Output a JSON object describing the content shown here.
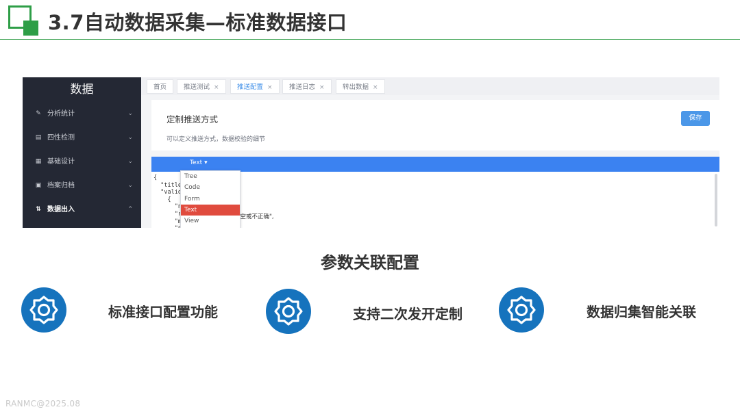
{
  "slide": {
    "title": "3.7自动数据采集—标准数据接口",
    "section_heading": "参数关联配置",
    "footer": "RANMC@2025.08"
  },
  "app": {
    "brand": "数据",
    "sidebar": [
      {
        "label": "分析统计",
        "icon": "edit-icon",
        "chevron": "⌄"
      },
      {
        "label": "四性检测",
        "icon": "calendar-icon",
        "chevron": "⌄"
      },
      {
        "label": "基础设计",
        "icon": "grid-icon",
        "chevron": "⌄"
      },
      {
        "label": "档案归档",
        "icon": "document-icon",
        "chevron": "⌄"
      },
      {
        "label": "数据出入",
        "icon": "transfer-icon",
        "chevron": "⌃",
        "active": true
      }
    ],
    "tabs": [
      {
        "label": "首页",
        "closable": false
      },
      {
        "label": "推送测试",
        "closable": true
      },
      {
        "label": "推送配置",
        "closable": true,
        "active": true
      },
      {
        "label": "推送日志",
        "closable": true
      },
      {
        "label": "转出数据",
        "closable": true
      }
    ],
    "panel": {
      "title": "定制推送方式",
      "description": "可以定义推送方式，数据校验的细节",
      "save_label": "保存"
    },
    "editor": {
      "mode_label": "Text ▾",
      "code_lines": [
        "{",
        "  \"title\"",
        "  \"valid",
        "    {",
        "      \"na",
        "      \"r",
        "      \"m",
        "      \"p",
        "    }"
      ],
      "code_tail": "为空或不正确\",",
      "mode_options": [
        "Tree",
        "Code",
        "Form",
        "Text",
        "View"
      ],
      "selected_mode": "Text"
    }
  },
  "features": [
    {
      "label": "标准接口配置功能",
      "icon": "gear-icon"
    },
    {
      "label": "支持二次发开定制",
      "icon": "gear-icon"
    },
    {
      "label": "数据归集智能关联",
      "icon": "gear-icon"
    }
  ],
  "colors": {
    "brand_green": "#2e9e47",
    "sidebar_bg": "#242834",
    "editor_bar": "#3b82f1",
    "save_button": "#4b97e8",
    "selected_option": "#e04b3e",
    "feature_icon": "#1673bd"
  }
}
